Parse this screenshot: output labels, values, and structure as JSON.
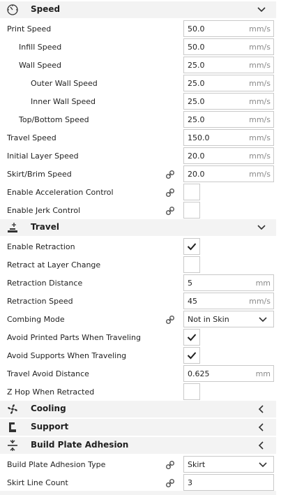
{
  "sections": {
    "speed": {
      "title": "Speed",
      "icon": "speedometer-icon"
    },
    "travel": {
      "title": "Travel",
      "icon": "travel-icon"
    },
    "cooling": {
      "title": "Cooling",
      "icon": "fan-icon"
    },
    "support": {
      "title": "Support",
      "icon": "support-icon"
    },
    "adhesion": {
      "title": "Build Plate Adhesion",
      "icon": "adhesion-icon"
    }
  },
  "speed": {
    "print_speed": {
      "label": "Print Speed",
      "value": "50.0",
      "unit": "mm/s"
    },
    "infill_speed": {
      "label": "Infill Speed",
      "value": "50.0",
      "unit": "mm/s"
    },
    "wall_speed": {
      "label": "Wall Speed",
      "value": "25.0",
      "unit": "mm/s"
    },
    "outer_wall_speed": {
      "label": "Outer Wall Speed",
      "value": "25.0",
      "unit": "mm/s"
    },
    "inner_wall_speed": {
      "label": "Inner Wall Speed",
      "value": "25.0",
      "unit": "mm/s"
    },
    "top_bottom_speed": {
      "label": "Top/Bottom Speed",
      "value": "25.0",
      "unit": "mm/s"
    },
    "travel_speed": {
      "label": "Travel Speed",
      "value": "150.0",
      "unit": "mm/s"
    },
    "initial_layer_speed": {
      "label": "Initial Layer Speed",
      "value": "20.0",
      "unit": "mm/s"
    },
    "skirt_brim_speed": {
      "label": "Skirt/Brim Speed",
      "value": "20.0",
      "unit": "mm/s"
    },
    "enable_acceleration": {
      "label": "Enable Acceleration Control",
      "checked": false
    },
    "enable_jerk": {
      "label": "Enable Jerk Control",
      "checked": false
    }
  },
  "travel": {
    "enable_retraction": {
      "label": "Enable Retraction",
      "checked": true
    },
    "retract_layer_change": {
      "label": "Retract at Layer Change",
      "checked": false
    },
    "retraction_distance": {
      "label": "Retraction Distance",
      "value": "5",
      "unit": "mm"
    },
    "retraction_speed": {
      "label": "Retraction Speed",
      "value": "45",
      "unit": "mm/s"
    },
    "combing_mode": {
      "label": "Combing Mode",
      "value": "Not in Skin"
    },
    "avoid_printed": {
      "label": "Avoid Printed Parts When Traveling",
      "checked": true
    },
    "avoid_supports": {
      "label": "Avoid Supports When Traveling",
      "checked": true
    },
    "travel_avoid_distance": {
      "label": "Travel Avoid Distance",
      "value": "0.625",
      "unit": "mm"
    },
    "z_hop": {
      "label": "Z Hop When Retracted",
      "checked": false
    }
  },
  "adhesion": {
    "adhesion_type": {
      "label": "Build Plate Adhesion Type",
      "value": "Skirt"
    },
    "skirt_line_count": {
      "label": "Skirt Line Count",
      "value": "3"
    }
  }
}
